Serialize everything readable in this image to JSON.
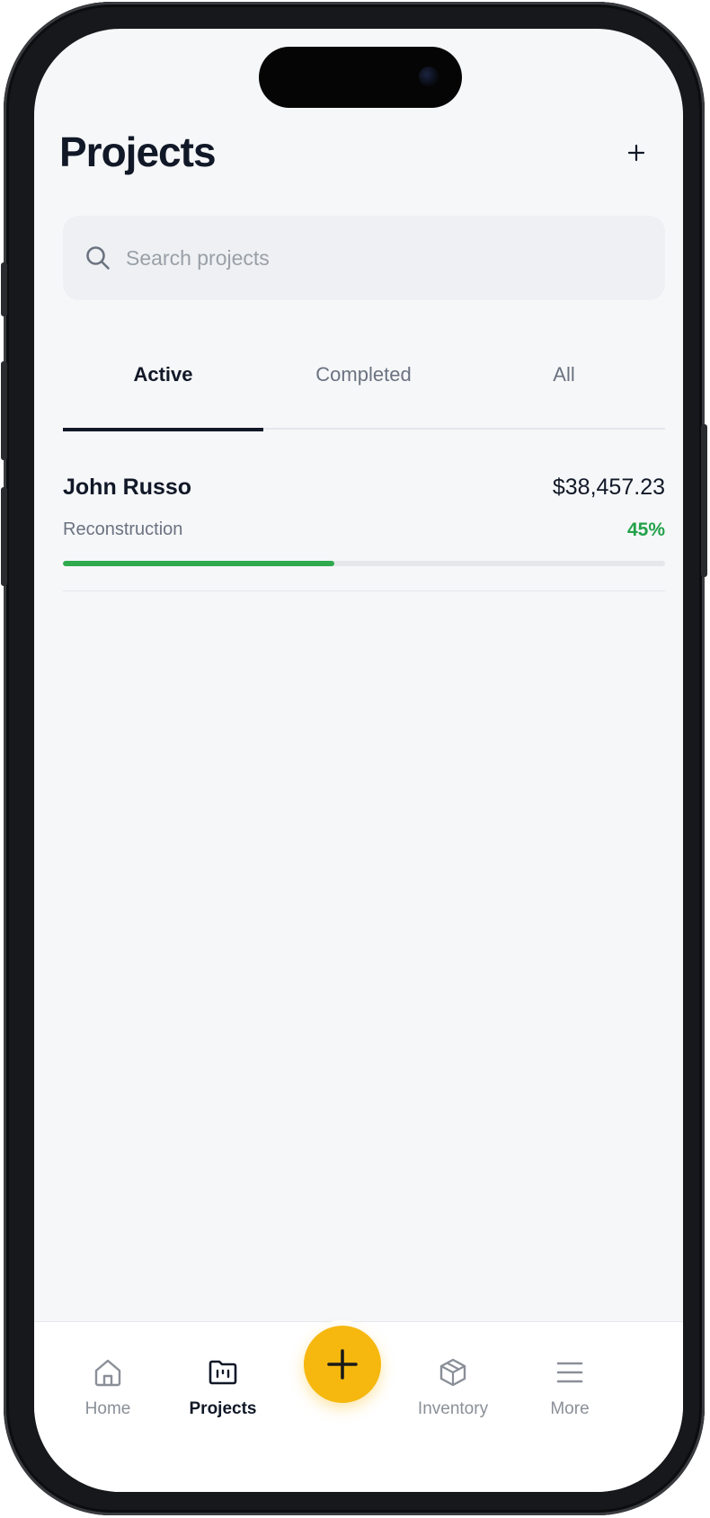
{
  "header": {
    "title": "Projects",
    "add_icon": "plus-icon"
  },
  "search": {
    "placeholder": "Search projects",
    "value": "",
    "icon": "search-icon"
  },
  "tabs": [
    {
      "label": "Active",
      "selected": true
    },
    {
      "label": "Completed",
      "selected": false
    },
    {
      "label": "All",
      "selected": false
    }
  ],
  "projects": [
    {
      "name": "John Russo",
      "type": "Reconstruction",
      "amount": "$38,457.23",
      "progress_label": "45%",
      "progress": 0.45
    }
  ],
  "bottom_nav": {
    "items": [
      {
        "label": "Home",
        "icon": "home-icon",
        "active": false
      },
      {
        "label": "Projects",
        "icon": "folder-icon",
        "active": true
      },
      {
        "label": "Inventory",
        "icon": "box-icon",
        "active": false
      },
      {
        "label": "More",
        "icon": "menu-icon",
        "active": false
      }
    ],
    "fab_icon": "plus-icon"
  },
  "colors": {
    "accent": "#f6b80f",
    "progress": "#2faa4e",
    "text_primary": "#111827"
  }
}
